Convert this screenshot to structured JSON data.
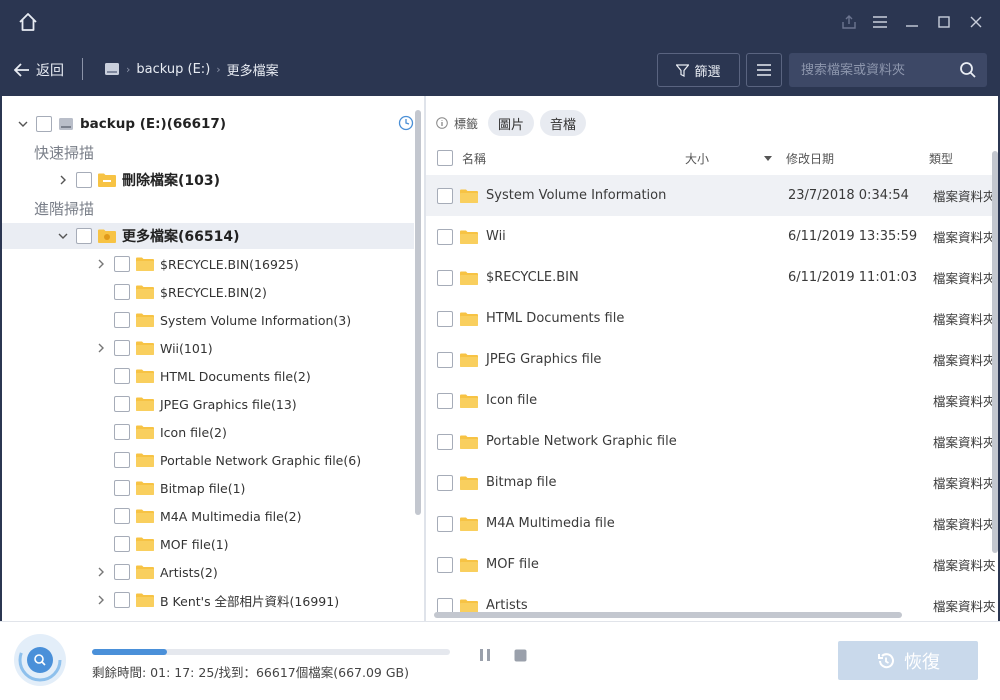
{
  "nav": {
    "back_label": "返回",
    "drive_label": "backup (E:)",
    "current_folder": "更多檔案",
    "filter_label": "篩選",
    "search_placeholder": "搜索檔案或資料夾"
  },
  "tree": {
    "root_label": "backup (E:)(66617)",
    "quick_scan_label": "快速掃描",
    "deleted_files_label": "刪除檔案(103)",
    "advanced_scan_label": "進階掃描",
    "more_files_label": "更多檔案(66514)",
    "children": [
      {
        "label": "$RECYCLE.BIN(16925)",
        "expandable": true
      },
      {
        "label": "$RECYCLE.BIN(2)",
        "expandable": false
      },
      {
        "label": "System Volume Information(3)",
        "expandable": false
      },
      {
        "label": "Wii(101)",
        "expandable": true
      },
      {
        "label": "HTML Documents file(2)",
        "expandable": false
      },
      {
        "label": "JPEG Graphics file(13)",
        "expandable": false
      },
      {
        "label": "Icon file(2)",
        "expandable": false
      },
      {
        "label": "Portable Network Graphic file(6)",
        "expandable": false
      },
      {
        "label": "Bitmap file(1)",
        "expandable": false
      },
      {
        "label": "M4A Multimedia file(2)",
        "expandable": false
      },
      {
        "label": "MOF file(1)",
        "expandable": false
      },
      {
        "label": "Artists(2)",
        "expandable": true
      },
      {
        "label": "B Kent's 全部相片資料(16991)",
        "expandable": true
      }
    ]
  },
  "filters": {
    "tags_label": "標籤",
    "chips": [
      "圖片",
      "音檔"
    ]
  },
  "columns": {
    "name": "名稱",
    "size": "大小",
    "modified": "修改日期",
    "type": "類型"
  },
  "files": [
    {
      "name": "System Volume Information",
      "date": "23/7/2018 0:34:54",
      "type": "檔案資料夾"
    },
    {
      "name": "Wii",
      "date": "6/11/2019 13:35:59",
      "type": "檔案資料夾"
    },
    {
      "name": "$RECYCLE.BIN",
      "date": "6/11/2019 11:01:03",
      "type": "檔案資料夾"
    },
    {
      "name": "HTML Documents file",
      "date": "",
      "type": "檔案資料夾"
    },
    {
      "name": "JPEG Graphics file",
      "date": "",
      "type": "檔案資料夾"
    },
    {
      "name": "Icon file",
      "date": "",
      "type": "檔案資料夾"
    },
    {
      "name": "Portable Network Graphic file",
      "date": "",
      "type": "檔案資料夾"
    },
    {
      "name": "Bitmap file",
      "date": "",
      "type": "檔案資料夾"
    },
    {
      "name": "M4A Multimedia file",
      "date": "",
      "type": "檔案資料夾"
    },
    {
      "name": "MOF file",
      "date": "",
      "type": "檔案資料夾"
    },
    {
      "name": "Artists",
      "date": "",
      "type": "檔案資料夾"
    }
  ],
  "footer": {
    "status_text": "剩餘時間: 01: 17: 25/找到：66617個檔案(667.09 GB)",
    "progress_fraction": 0.21,
    "recover_label": "恢復"
  },
  "colors": {
    "chrome": "#2b3651",
    "folder": "#f7c344",
    "accent": "#4a90d9",
    "recover_button": "#c9d9eb"
  }
}
